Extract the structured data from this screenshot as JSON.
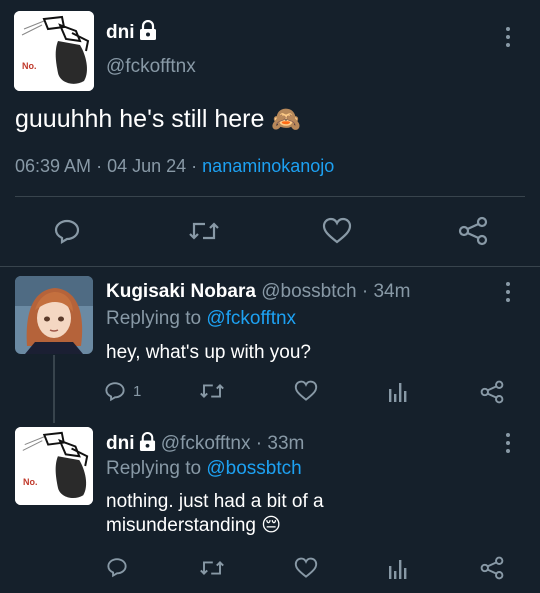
{
  "main_tweet": {
    "display_name": "dni",
    "handle": "@fckofftnx",
    "avatar_label": "No.",
    "text": "guuuhhh he's still here",
    "emoji": "🙈",
    "time": "06:39 AM",
    "date": "04 Jun 24",
    "source": "nanaminokanojo"
  },
  "replies": [
    {
      "display_name": "Kugisaki Nobara",
      "handle": "@bossbtch",
      "age": "34m",
      "replying_prefix": "Replying to",
      "replying_to": "@fckofftnx",
      "text": "hey, what's up with you?",
      "reply_count": "1"
    },
    {
      "display_name": "dni",
      "handle": "@fckofftnx",
      "age": "33m",
      "avatar_label": "No.",
      "replying_prefix": "Replying to",
      "replying_to": "@bossbtch",
      "text_line1": "nothing. just had a bit of a",
      "text_line2": "misunderstanding",
      "emoji": "😔"
    }
  ],
  "colors": {
    "background": "#15202b",
    "secondary_text": "#8899a6",
    "accent": "#1da1f2",
    "divider": "#38444d"
  }
}
